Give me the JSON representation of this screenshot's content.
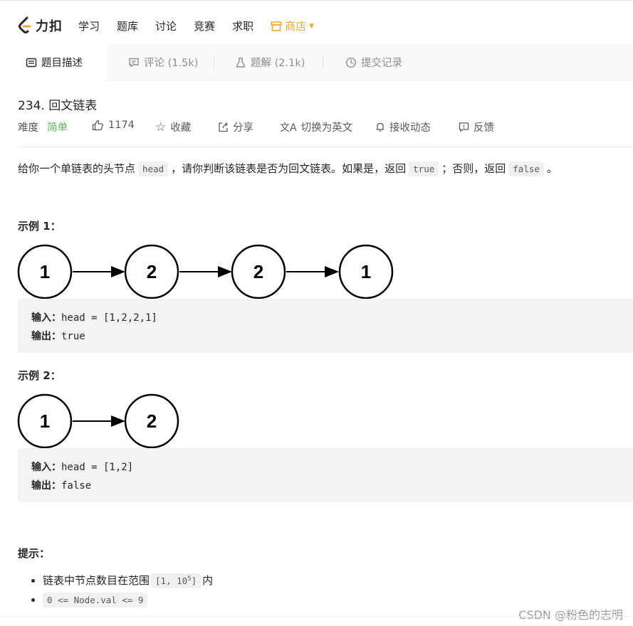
{
  "brand": {
    "name": "力扣"
  },
  "nav": {
    "items": [
      "学习",
      "题库",
      "讨论",
      "竞赛",
      "求职"
    ],
    "shop": "商店"
  },
  "tabs": [
    {
      "label": "题目描述"
    },
    {
      "label": "评论 (1.5k)"
    },
    {
      "label": "题解 (2.1k)"
    },
    {
      "label": "提交记录"
    }
  ],
  "problem": {
    "title": "234. 回文链表",
    "difficulty_label": "难度",
    "difficulty": "简单",
    "likes": "1174",
    "actions": [
      "收藏",
      "分享",
      "切换为英文",
      "接收动态",
      "反馈"
    ],
    "desc_1": "给你一个单链表的头节点",
    "desc_code_1": "head",
    "desc_2": "，请你判断该链表是否为回文链表。如果是，返回",
    "desc_code_2": "true",
    "desc_3": "；否则，返回",
    "desc_code_3": "false",
    "desc_4": "。"
  },
  "examples": [
    {
      "heading": "示例 1：",
      "nodes": [
        "1",
        "2",
        "2",
        "1"
      ],
      "input_label": "输入：",
      "input": "head = [1,2,2,1]",
      "output_label": "输出：",
      "output": "true"
    },
    {
      "heading": "示例 2：",
      "nodes": [
        "1",
        "2"
      ],
      "input_label": "输入：",
      "input": "head = [1,2]",
      "output_label": "输出：",
      "output": "false"
    }
  ],
  "hints": {
    "heading": "提示：",
    "h1_text": "链表中节点数目在范围",
    "h1_code_a": "[1, 10",
    "h1_sup": "5",
    "h1_code_b": "]",
    "h1_tail": "内",
    "h2_code": "0 <= Node.val <= 9"
  },
  "watermark": "CSDN @粉色的志明",
  "colors": {
    "accent_orange": "#f5a623",
    "easy_green": "#5cb85c"
  }
}
